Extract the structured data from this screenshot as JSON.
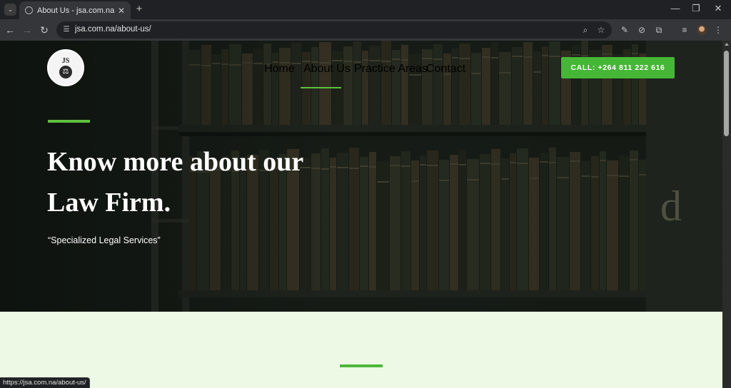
{
  "browser": {
    "tab_title": "About Us - jsa.com.na",
    "url": "jsa.com.na/about-us/",
    "status_url": "https://jsa.com.na/about-us/",
    "icons": [
      "tab-search-icon",
      "globe-icon",
      "close-icon",
      "plus-icon",
      "minimize-icon",
      "restore-icon",
      "close-window-icon",
      "back-icon",
      "forward-icon",
      "reload-icon",
      "site-info-icon",
      "zoom-icon",
      "star-icon",
      "eyedropper-icon",
      "extension-disabled-icon",
      "puzzle-icon",
      "media-queue-icon",
      "avatar",
      "kebab-menu-icon"
    ]
  },
  "site": {
    "logo": {
      "monogram": "JS",
      "icon": "scales-of-justice-icon"
    },
    "nav": [
      {
        "label": "Home"
      },
      {
        "label": "About Us"
      },
      {
        "label": "Practice Areas"
      },
      {
        "label": "Contact"
      }
    ],
    "active_nav": "About Us",
    "call_button": "CALL: +264 811 222 616",
    "hero": {
      "title_line1": "Know more about our",
      "title_line2": "Law Firm.",
      "subtitle": "“Specialized Legal Services”",
      "background_letter": "d"
    },
    "colors": {
      "accent_green": "#5fc03f",
      "button_green": "#46b636",
      "section_bg": "#eef9e5"
    }
  }
}
